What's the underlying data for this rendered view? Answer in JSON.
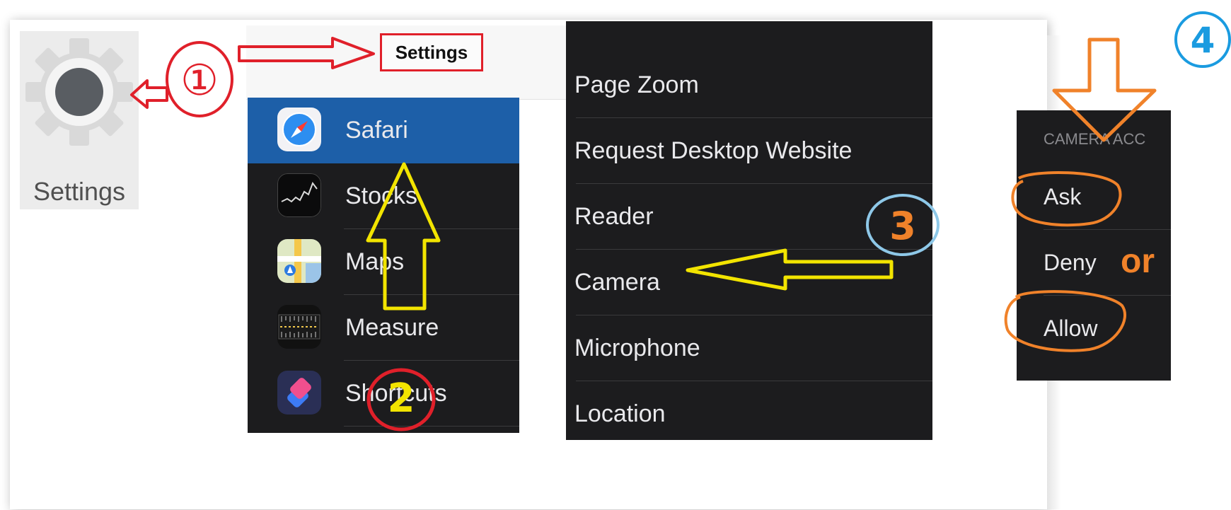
{
  "home": {
    "settings_label": "Settings"
  },
  "header": {
    "settings_title": "Settings"
  },
  "apps": [
    {
      "label": "Safari",
      "icon": "safari-icon"
    },
    {
      "label": "Stocks",
      "icon": "stocks-icon"
    },
    {
      "label": "Maps",
      "icon": "maps-icon"
    },
    {
      "label": "Measure",
      "icon": "measure-icon"
    },
    {
      "label": "Shortcuts",
      "icon": "shortcuts-icon"
    }
  ],
  "safari_settings": [
    "Page Zoom",
    "Request Desktop Website",
    "Reader",
    "Camera",
    "Microphone",
    "Location"
  ],
  "camera_access": {
    "header": "CAMERA ACC",
    "options": [
      "Ask",
      "Deny",
      "Allow"
    ],
    "or_text": "or"
  },
  "steps": [
    "①",
    "2",
    "3",
    "4"
  ],
  "colors": {
    "step1": "#e0202a",
    "step2_circle": "#e0202a",
    "step2_number": "#f2e400",
    "step3_circle": "#8ec8e8",
    "step3_number": "#f0822a",
    "step4_circle": "#1a9be0",
    "step4_number": "#1a9be0",
    "yellow_arrow": "#f2e400",
    "orange": "#f0822a",
    "safari_highlight": "#1d5fa8",
    "dark_panel": "#1c1c1e"
  }
}
